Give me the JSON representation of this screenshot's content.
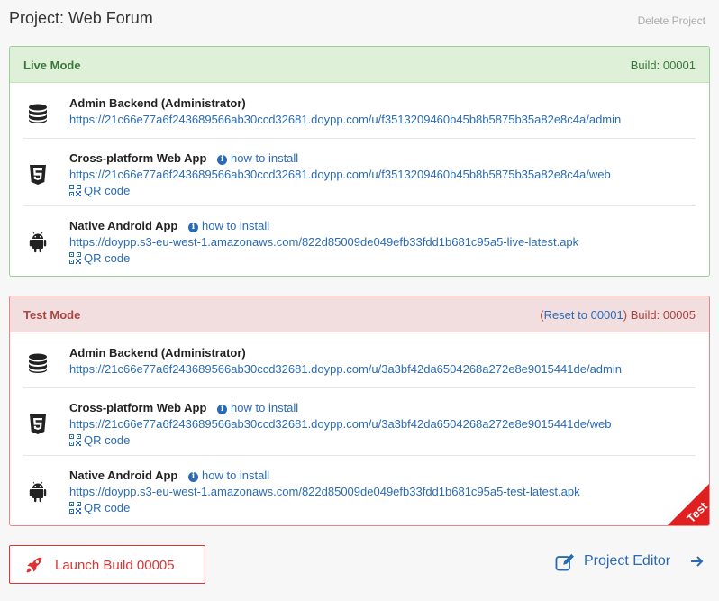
{
  "header": {
    "title": "Project: Web Forum",
    "delete_label": "Delete Project"
  },
  "live": {
    "mode_label": "Live Mode",
    "build_label": "Build: 00001",
    "rows": [
      {
        "name": "Admin Backend (Administrator)",
        "url": "https://21c66e77a6f243689566ab30ccd32681.doypp.com/u/f3513209460b45b8b5875b35a82e8c4a/admin"
      },
      {
        "name": "Cross-platform Web App",
        "howto": "how to install",
        "url": "https://21c66e77a6f243689566ab30ccd32681.doypp.com/u/f3513209460b45b8b5875b35a82e8c4a/web",
        "qr": "QR code"
      },
      {
        "name": "Native Android App",
        "howto": "how to install",
        "url": "https://doypp.s3-eu-west-1.amazonaws.com/822d85009de049efb33fdd1b681c95a5-live-latest.apk",
        "qr": "QR code"
      }
    ]
  },
  "test": {
    "mode_label": "Test Mode",
    "reset_open": "(",
    "reset_label": "Reset to 00001",
    "reset_close": ")",
    "build_label": "Build: 00005",
    "ribbon_label": "Test",
    "rows": [
      {
        "name": "Admin Backend (Administrator)",
        "url": "https://21c66e77a6f243689566ab30ccd32681.doypp.com/u/3a3bf42da6504268a272e8e9015441de/admin"
      },
      {
        "name": "Cross-platform Web App",
        "howto": "how to install",
        "url": "https://21c66e77a6f243689566ab30ccd32681.doypp.com/u/3a3bf42da6504268a272e8e9015441de/web",
        "qr": "QR code"
      },
      {
        "name": "Native Android App",
        "howto": "how to install",
        "url": "https://doypp.s3-eu-west-1.amazonaws.com/822d85009de049efb33fdd1b681c95a5-test-latest.apk",
        "qr": "QR code"
      }
    ]
  },
  "footer": {
    "launch_label": "Launch Build 00005",
    "editor_label": "Project Editor"
  },
  "colors": {
    "link": "#2a6bb5",
    "live_accent": "#3c763d",
    "test_accent": "#a94442",
    "launch_red": "#dd3333"
  },
  "icons": [
    "database-icon",
    "html5-icon",
    "android-icon",
    "info-icon",
    "qr-code-icon",
    "rocket-icon",
    "edit-icon",
    "arrow-right-icon"
  ]
}
